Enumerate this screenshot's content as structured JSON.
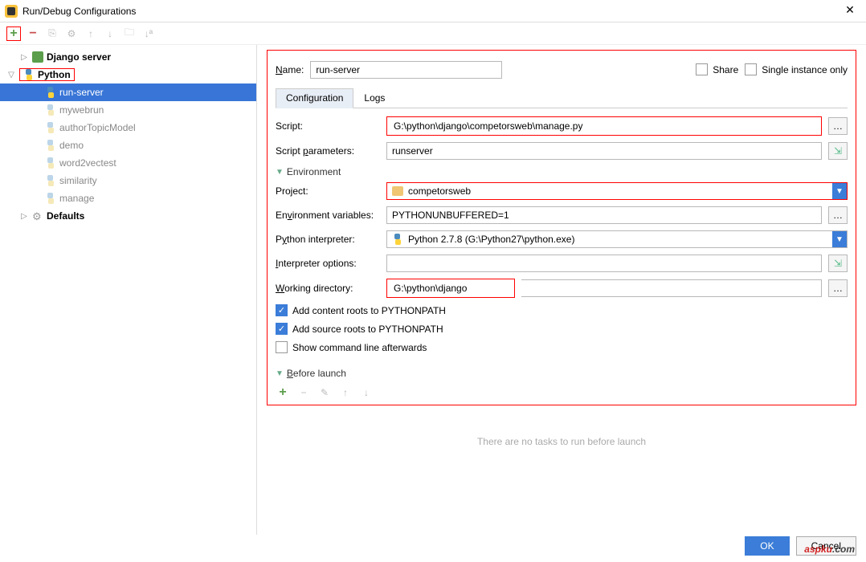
{
  "titlebar": {
    "title": "Run/Debug Configurations"
  },
  "tree": {
    "django_server": "Django server",
    "python": "Python",
    "items": [
      "run-server",
      "mywebrun",
      "authorTopicModel",
      "demo",
      "word2vectest",
      "similarity",
      "manage"
    ],
    "defaults": "Defaults"
  },
  "form": {
    "name_label": "Name:",
    "name_value": "run-server",
    "share": "Share",
    "single_instance": "Single instance only",
    "tabs": {
      "config": "Configuration",
      "logs": "Logs"
    },
    "script_label": "Script:",
    "script_value": "G:\\python\\django\\competorsweb\\manage.py",
    "script_params_label": "Script parameters:",
    "script_params_value": "runserver",
    "environment_label": "Environment",
    "project_label": "Project:",
    "project_value": "competorsweb",
    "envvars_label": "Environment variables:",
    "envvars_value": "PYTHONUNBUFFERED=1",
    "interpreter_label": "Python interpreter:",
    "interpreter_value": "Python 2.7.8 (G:\\Python27\\python.exe)",
    "interp_opts_label": "Interpreter options:",
    "interp_opts_value": "",
    "wd_label": "Working directory:",
    "wd_value": "G:\\python\\django",
    "add_content_roots": "Add content roots to PYTHONPATH",
    "add_source_roots": "Add source roots to PYTHONPATH",
    "show_cmd": "Show command line afterwards",
    "before_launch": "Before launch",
    "no_tasks": "There are no tasks to run before launch"
  },
  "buttons": {
    "ok": "OK",
    "cancel": "Cancel"
  },
  "watermark": {
    "brand": "aspku",
    "dot": ".",
    "tld": "com"
  }
}
